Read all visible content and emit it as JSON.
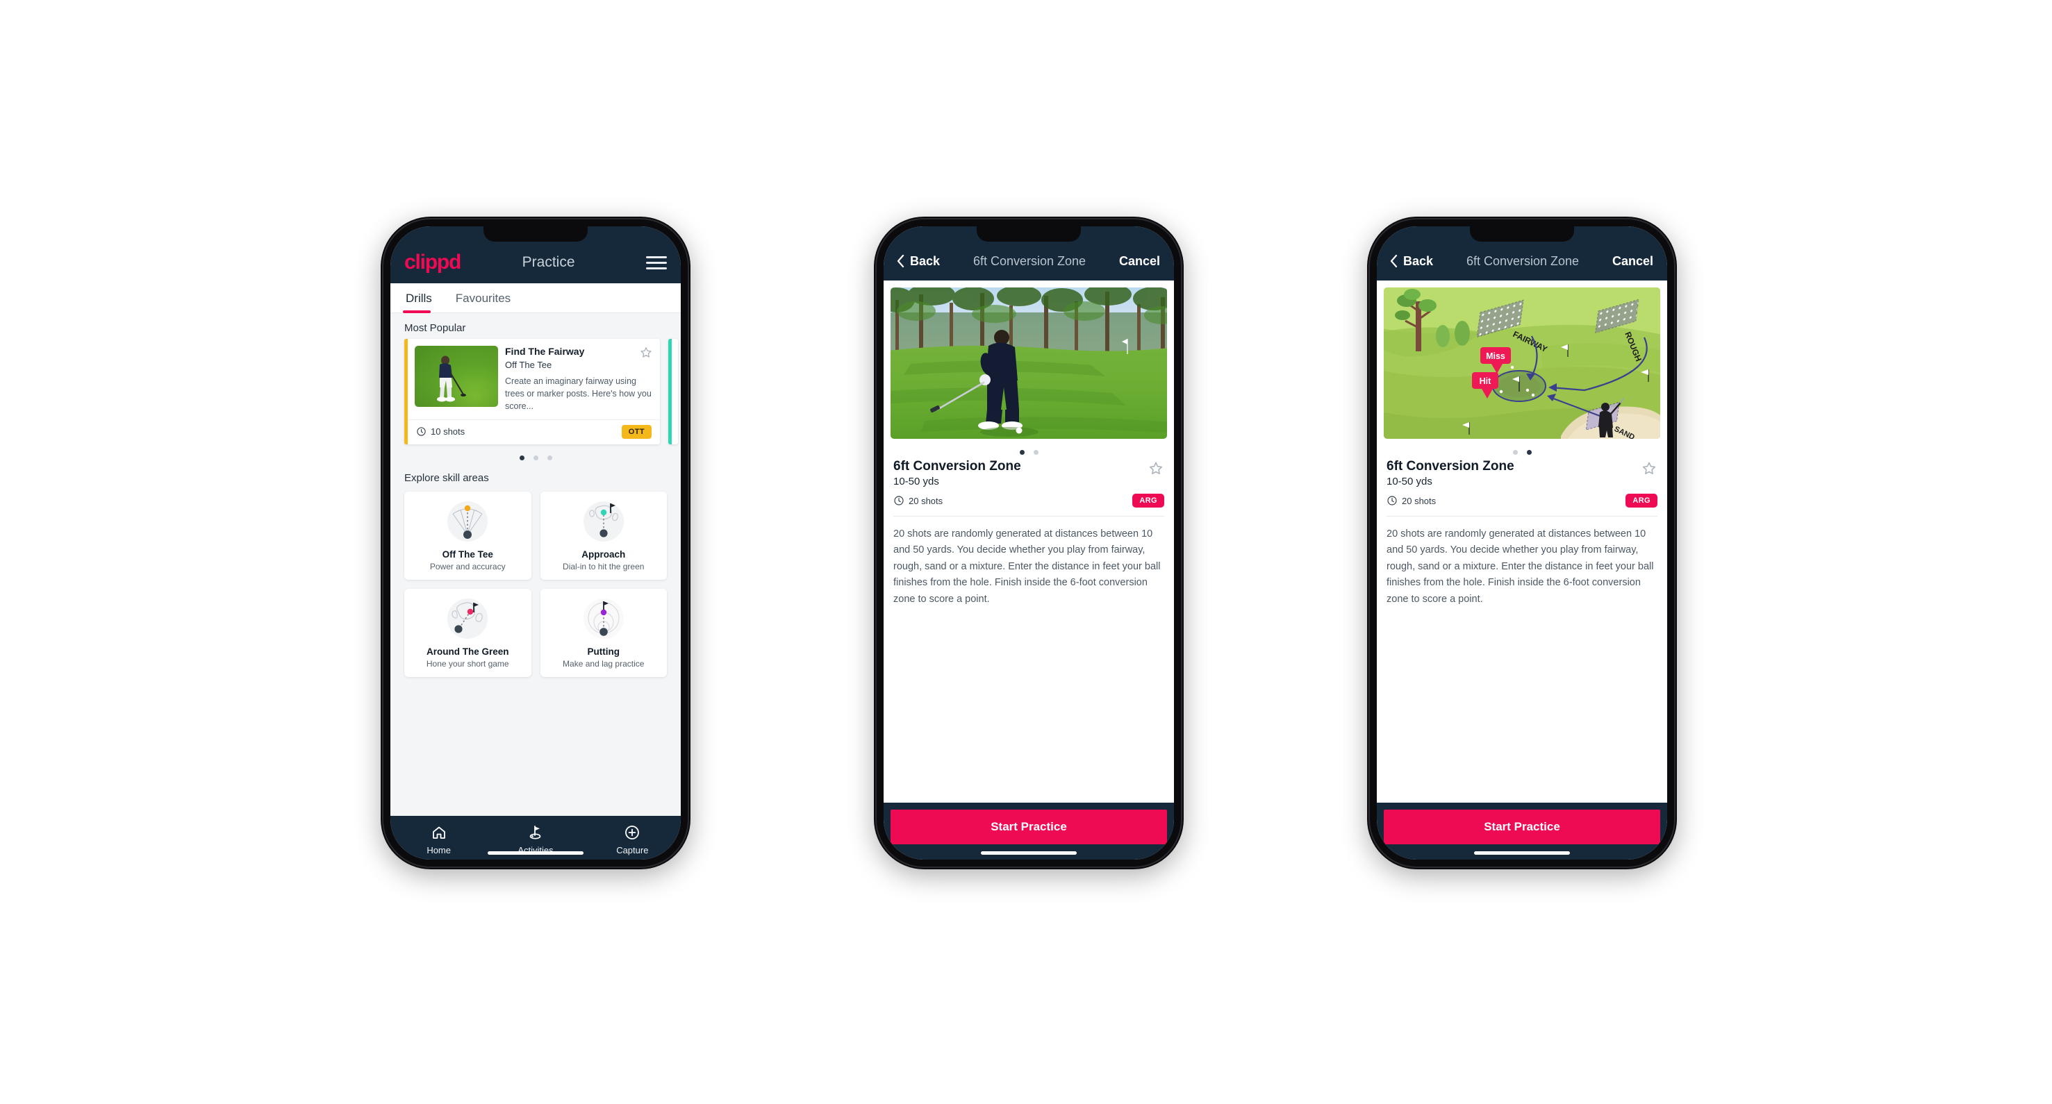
{
  "app": {
    "brand": "clippd",
    "accent_pink": "#ef0b54",
    "navy": "#16293a",
    "amber": "#f5b81a",
    "teal": "#2fd6b5"
  },
  "phone1": {
    "header": {
      "logo": "clippd",
      "title": "Practice",
      "menu_icon": "hamburger-menu-icon"
    },
    "tabs": [
      {
        "label": "Drills",
        "active": true
      },
      {
        "label": "Favourites",
        "active": false
      }
    ],
    "most_popular": {
      "section_label": "Most Popular",
      "card": {
        "title": "Find The Fairway",
        "category": "Off The Tee",
        "description": "Create an imaginary fairway using trees or marker posts. Here's how you score...",
        "shots": "10 shots",
        "badge": "OTT",
        "badge_color": "#f5b81a",
        "favourite_icon": "star-outline-icon",
        "shots_icon": "clock-icon"
      },
      "dots": [
        {
          "active": true
        },
        {
          "active": false
        },
        {
          "active": false
        }
      ]
    },
    "explore": {
      "section_label": "Explore skill areas",
      "cards": [
        {
          "name": "Off The Tee",
          "subtitle": "Power and accuracy",
          "icon": "tee-fan-icon",
          "dot_color": "#f5a81a"
        },
        {
          "name": "Approach",
          "subtitle": "Dial-in to hit the green",
          "icon": "approach-green-icon",
          "dot_color": "#2fd6b5"
        },
        {
          "name": "Around The Green",
          "subtitle": "Hone your short game",
          "icon": "chip-green-icon",
          "dot_color": "#ef2a62"
        },
        {
          "name": "Putting",
          "subtitle": "Make and lag practice",
          "icon": "putting-rings-icon",
          "dot_color": "#9b24d6"
        }
      ]
    },
    "bottom_nav": [
      {
        "label": "Home",
        "icon": "home-icon",
        "active": false
      },
      {
        "label": "Activities",
        "icon": "golf-flag-icon",
        "active": true
      },
      {
        "label": "Capture",
        "icon": "plus-circle-icon",
        "active": false
      }
    ]
  },
  "phone2": {
    "header": {
      "back": "Back",
      "back_icon": "chevron-left-icon",
      "title": "6ft Conversion Zone",
      "cancel": "Cancel"
    },
    "media": {
      "type": "photo",
      "alt": "golfer-chipping-photo"
    },
    "dots": [
      {
        "active": true
      },
      {
        "active": false
      }
    ],
    "detail": {
      "name": "6ft Conversion Zone",
      "distance": "10-50 yds",
      "shots": "20 shots",
      "shots_icon": "clock-icon",
      "badge": "ARG",
      "badge_color": "#ef0b54",
      "favourite_icon": "star-outline-icon",
      "description": "20 shots are randomly generated at distances between 10 and 50 yards. You decide whether you play from fairway, rough, sand or a mixture. Enter the distance in feet your ball finishes from the hole. Finish inside the 6-foot conversion zone to score a point."
    },
    "cta": "Start Practice"
  },
  "phone3": {
    "header": {
      "back": "Back",
      "back_icon": "chevron-left-icon",
      "title": "6ft Conversion Zone",
      "cancel": "Cancel"
    },
    "media": {
      "type": "illustration",
      "alt": "golf-course-diagram",
      "labels": {
        "fairway": "FAIRWAY",
        "rough": "ROUGH",
        "sand": "SAND",
        "miss": "Miss",
        "hit": "Hit"
      }
    },
    "dots": [
      {
        "active": false
      },
      {
        "active": true
      }
    ],
    "detail": {
      "name": "6ft Conversion Zone",
      "distance": "10-50 yds",
      "shots": "20 shots",
      "shots_icon": "clock-icon",
      "badge": "ARG",
      "badge_color": "#ef0b54",
      "favourite_icon": "star-outline-icon",
      "description": "20 shots are randomly generated at distances between 10 and 50 yards. You decide whether you play from fairway, rough, sand or a mixture. Enter the distance in feet your ball finishes from the hole. Finish inside the 6-foot conversion zone to score a point."
    },
    "cta": "Start Practice"
  }
}
